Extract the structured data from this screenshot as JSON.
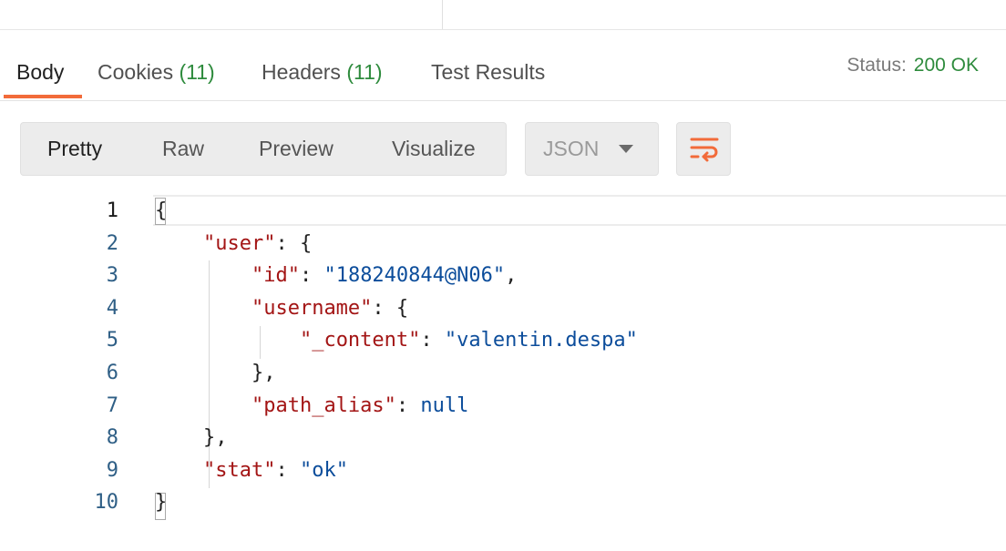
{
  "tabs": [
    {
      "label": "Body",
      "count": ""
    },
    {
      "label": "Cookies",
      "count": "(11)"
    },
    {
      "label": "Headers",
      "count": "(11)"
    },
    {
      "label": "Test Results",
      "count": ""
    }
  ],
  "status": {
    "label": "Status:",
    "value": "200 OK"
  },
  "view_modes": [
    "Pretty",
    "Raw",
    "Preview",
    "Visualize"
  ],
  "format": {
    "selected": "JSON"
  },
  "icons": {
    "wrap": "wrap-lines-icon",
    "caret": "chevron-down-icon"
  },
  "colors": {
    "accent": "#f26b3a",
    "status_ok": "#2e8b3d",
    "key": "#a31515",
    "value": "#0c4d9b"
  },
  "editor": {
    "line_numbers": [
      "1",
      "2",
      "3",
      "4",
      "5",
      "6",
      "7",
      "8",
      "9",
      "10"
    ],
    "lines": [
      [
        {
          "t": "p",
          "v": "{"
        }
      ],
      [
        {
          "t": "p",
          "v": "    "
        },
        {
          "t": "k",
          "v": "\"user\""
        },
        {
          "t": "p",
          "v": ": {"
        }
      ],
      [
        {
          "t": "p",
          "v": "        "
        },
        {
          "t": "k",
          "v": "\"id\""
        },
        {
          "t": "p",
          "v": ": "
        },
        {
          "t": "s",
          "v": "\"188240844@N06\""
        },
        {
          "t": "p",
          "v": ","
        }
      ],
      [
        {
          "t": "p",
          "v": "        "
        },
        {
          "t": "k",
          "v": "\"username\""
        },
        {
          "t": "p",
          "v": ": {"
        }
      ],
      [
        {
          "t": "p",
          "v": "            "
        },
        {
          "t": "k",
          "v": "\"_content\""
        },
        {
          "t": "p",
          "v": ": "
        },
        {
          "t": "s",
          "v": "\"valentin.despa\""
        }
      ],
      [
        {
          "t": "p",
          "v": "        },"
        }
      ],
      [
        {
          "t": "p",
          "v": "        "
        },
        {
          "t": "k",
          "v": "\"path_alias\""
        },
        {
          "t": "p",
          "v": ": "
        },
        {
          "t": "n",
          "v": "null"
        }
      ],
      [
        {
          "t": "p",
          "v": "    },"
        }
      ],
      [
        {
          "t": "p",
          "v": "    "
        },
        {
          "t": "k",
          "v": "\"stat\""
        },
        {
          "t": "p",
          "v": ": "
        },
        {
          "t": "s",
          "v": "\"ok\""
        }
      ],
      [
        {
          "t": "p",
          "v": "}"
        }
      ]
    ]
  }
}
